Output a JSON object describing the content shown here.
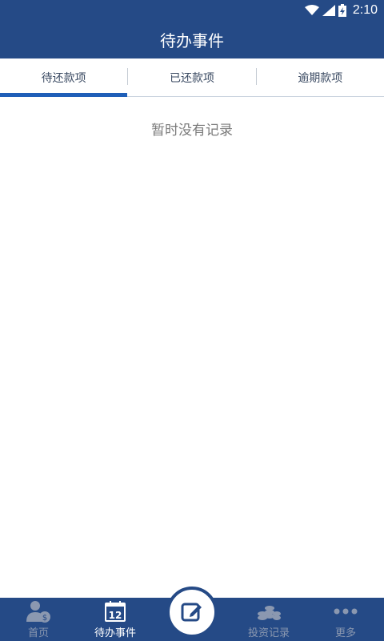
{
  "status_bar": {
    "time": "2:10"
  },
  "header": {
    "title": "待办事件"
  },
  "tabs": [
    {
      "label": "待还款项",
      "active": true
    },
    {
      "label": "已还款项",
      "active": false
    },
    {
      "label": "逾期款项",
      "active": false
    }
  ],
  "empty_state": {
    "text": "暂时没有记录"
  },
  "bottom_nav": {
    "items": [
      {
        "label": "首页",
        "icon": "user-money-icon"
      },
      {
        "label": "待办事件",
        "icon": "calendar-icon",
        "calendar_day": "12",
        "active": true
      },
      {
        "label": "",
        "icon": "edit-icon"
      },
      {
        "label": "投资记录",
        "icon": "coins-icon"
      },
      {
        "label": "更多",
        "icon": "more-dots-icon"
      }
    ]
  },
  "colors": {
    "primary": "#254a86",
    "tab_indicator": "#1f5fb8",
    "inactive_nav": "#8b98b0"
  }
}
